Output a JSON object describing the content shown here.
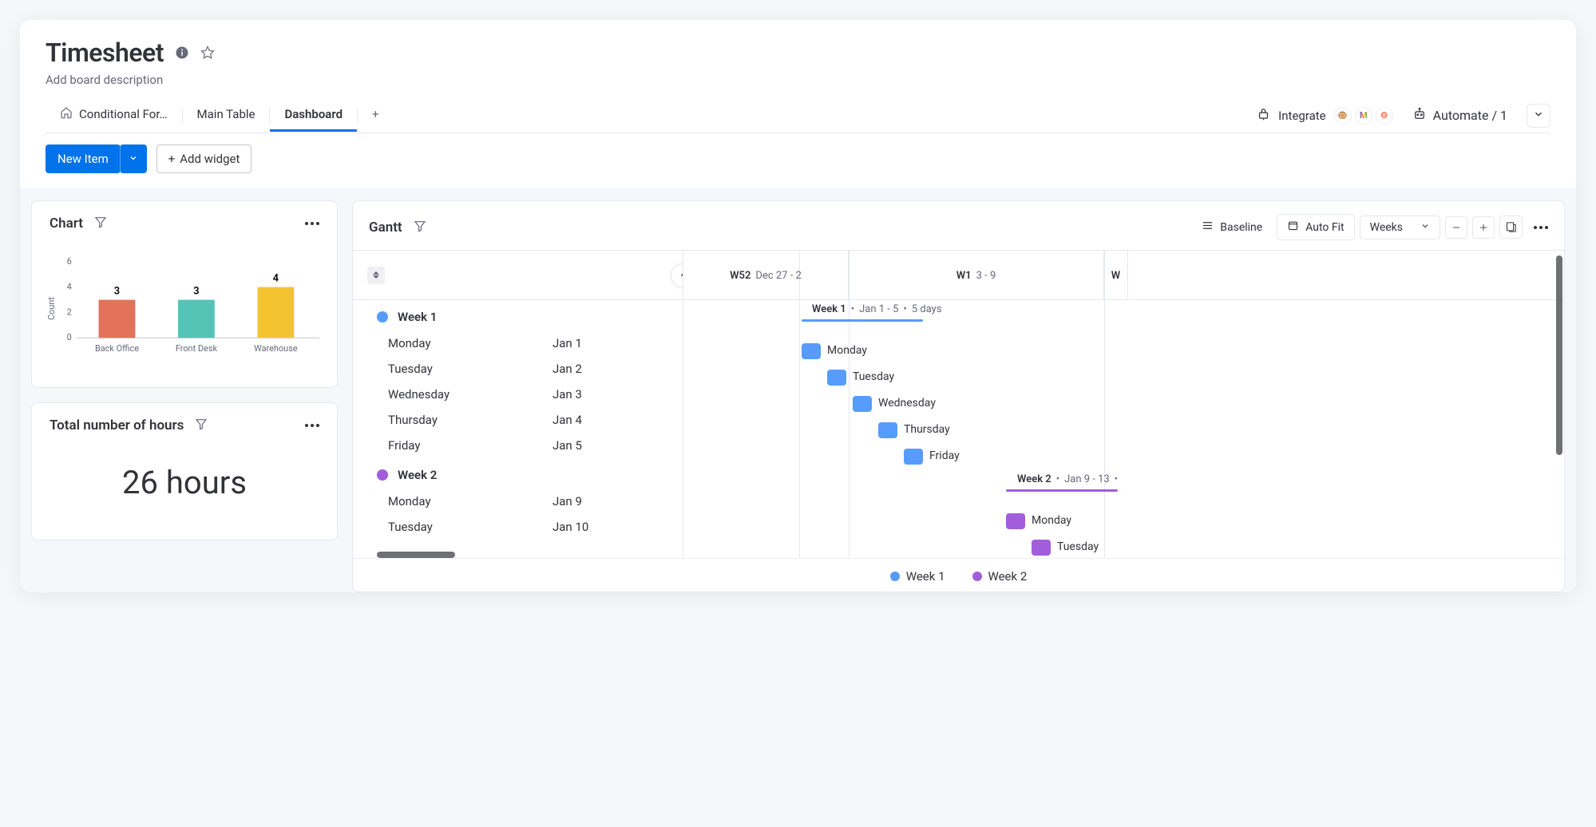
{
  "header": {
    "title": "Timesheet",
    "subtitle": "Add board description"
  },
  "tabs": {
    "t0": "Conditional For…",
    "t1": "Main Table",
    "t2": "Dashboard"
  },
  "integrate": {
    "label": "Integrate"
  },
  "automate": {
    "label": "Automate / 1"
  },
  "toolbar": {
    "new_item": "New Item",
    "add_widget": "Add widget"
  },
  "chart_widget": {
    "title": "Chart"
  },
  "chart_data": {
    "type": "bar",
    "categories": [
      "Back Office",
      "Front Desk",
      "Warehouse"
    ],
    "values": [
      3,
      3,
      4
    ],
    "colors": [
      "#e2735a",
      "#55c3b6",
      "#f4c430"
    ],
    "ylabel": "Count",
    "ylim": [
      0,
      6
    ],
    "yticks": [
      0,
      2,
      4,
      6
    ]
  },
  "hours_widget": {
    "title": "Total number of hours",
    "value": "26 hours"
  },
  "gantt": {
    "title": "Gantt",
    "controls": {
      "baseline": "Baseline",
      "autofit": "Auto Fit",
      "period": "Weeks"
    },
    "weeks_header": {
      "w52": {
        "label": "W52",
        "range": "Dec 27 - 2"
      },
      "w1": {
        "label": "W1",
        "range": "3 - 9"
      },
      "w2": {
        "label": "W"
      }
    },
    "groups": {
      "week1": {
        "name": "Week 1",
        "color": "#579bfc",
        "summary": {
          "title": "Week 1",
          "range": "Jan 1 - 5",
          "duration": "5 days"
        },
        "tasks": [
          {
            "name": "Monday",
            "date": "Jan 1"
          },
          {
            "name": "Tuesday",
            "date": "Jan 2"
          },
          {
            "name": "Wednesday",
            "date": "Jan 3"
          },
          {
            "name": "Thursday",
            "date": "Jan 4"
          },
          {
            "name": "Friday",
            "date": "Jan 5"
          }
        ]
      },
      "week2": {
        "name": "Week 2",
        "color": "#a25ddc",
        "summary": {
          "title": "Week 2",
          "range": "Jan 9 - 13"
        },
        "tasks": [
          {
            "name": "Monday",
            "date": "Jan 9"
          },
          {
            "name": "Tuesday",
            "date": "Jan 10"
          }
        ]
      }
    },
    "legend": {
      "l1": "Week 1",
      "l2": "Week 2"
    }
  }
}
